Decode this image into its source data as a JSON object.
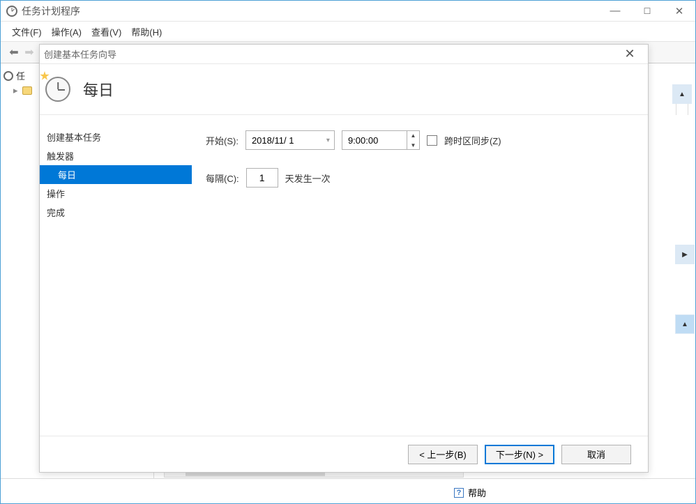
{
  "main_window": {
    "title": "任务计划程序"
  },
  "menu": {
    "file": "文件(F)",
    "action": "操作(A)",
    "view": "查看(V)",
    "help": "帮助(H)"
  },
  "tree": {
    "root": "任"
  },
  "dialog": {
    "title": "创建基本任务向导",
    "header_title": "每日",
    "nav": {
      "create_basic": "创建基本任务",
      "trigger": "触发器",
      "daily": "每日",
      "action": "操作",
      "finish": "完成"
    },
    "form": {
      "start_label": "开始(S):",
      "date_value": "2018/11/ 1",
      "time_value": "9:00:00",
      "sync_tz_label": "跨时区同步(Z)",
      "interval_label": "每隔(C):",
      "interval_value": "1",
      "interval_suffix": "天发生一次"
    },
    "buttons": {
      "back": "< 上一步(B)",
      "next": "下一步(N) >",
      "cancel": "取消"
    }
  },
  "bottom_help": "帮助"
}
